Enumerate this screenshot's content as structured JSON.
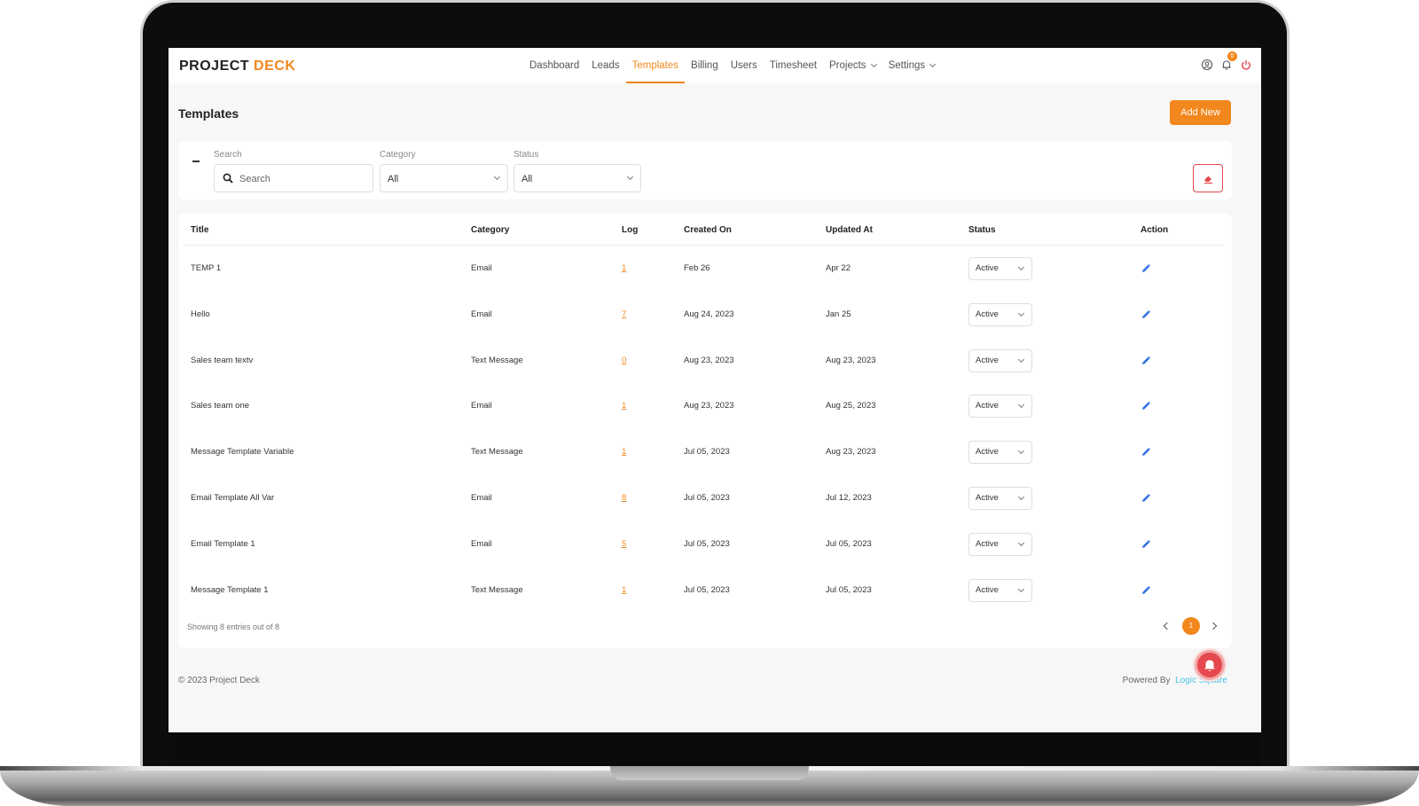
{
  "brand": {
    "name_part1": "PROJECT",
    "name_part2": "DECK"
  },
  "nav": {
    "items": [
      {
        "label": "Dashboard"
      },
      {
        "label": "Leads"
      },
      {
        "label": "Templates",
        "active": true
      },
      {
        "label": "Billing"
      },
      {
        "label": "Users"
      },
      {
        "label": "Timesheet"
      },
      {
        "label": "Projects",
        "dropdown": true
      },
      {
        "label": "Settings",
        "dropdown": true
      }
    ],
    "notification_count": "0"
  },
  "page": {
    "title": "Templates",
    "add_button": "Add New"
  },
  "filters": {
    "collapse_symbol": "–",
    "search_label": "Search",
    "search_placeholder": "Search",
    "category_label": "Category",
    "category_value": "All",
    "status_label": "Status",
    "status_value": "All"
  },
  "table": {
    "columns": [
      "Title",
      "Category",
      "Log",
      "Created On",
      "Updated At",
      "Status",
      "Action"
    ],
    "rows": [
      {
        "title": "TEMP 1",
        "category": "Email",
        "log": "1",
        "created": "Feb 26",
        "updated": "Apr 22",
        "status": "Active"
      },
      {
        "title": "Hello",
        "category": "Email",
        "log": "7",
        "created": "Aug 24, 2023",
        "updated": "Jan 25",
        "status": "Active"
      },
      {
        "title": "Sales team textv",
        "category": "Text Message",
        "log": "0",
        "created": "Aug 23, 2023",
        "updated": "Aug 23, 2023",
        "status": "Active"
      },
      {
        "title": "Sales team one",
        "category": "Email",
        "log": "1",
        "created": "Aug 23, 2023",
        "updated": "Aug 25, 2023",
        "status": "Active"
      },
      {
        "title": "Message Template Variable",
        "category": "Text Message",
        "log": "1",
        "created": "Jul 05, 2023",
        "updated": "Aug 23, 2023",
        "status": "Active"
      },
      {
        "title": "Email Template All Var",
        "category": "Email",
        "log": "8",
        "created": "Jul 05, 2023",
        "updated": "Jul 12, 2023",
        "status": "Active"
      },
      {
        "title": "Email Template 1",
        "category": "Email",
        "log": "5",
        "created": "Jul 05, 2023",
        "updated": "Jul 05, 2023",
        "status": "Active"
      },
      {
        "title": "Message Template 1",
        "category": "Text Message",
        "log": "1",
        "created": "Jul 05, 2023",
        "updated": "Jul 05, 2023",
        "status": "Active"
      }
    ],
    "showing_text": "Showing 8 entries out of 8",
    "current_page": "1"
  },
  "footer": {
    "copyright": "© 2023 Project Deck",
    "powered_by": "Powered By",
    "powered_by_link": "Logic Square"
  },
  "colors": {
    "accent": "#f2871d",
    "danger": "#e5484d",
    "link": "#4ec4e8",
    "edit": "#2f6fe4"
  }
}
